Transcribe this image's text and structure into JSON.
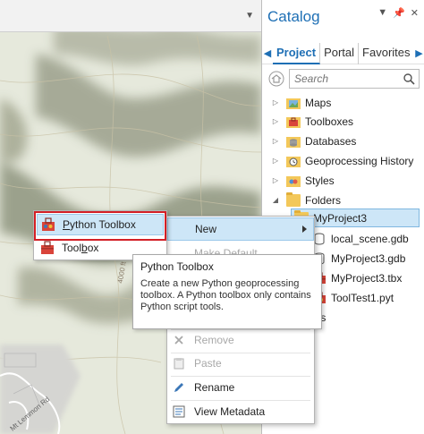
{
  "catalog": {
    "title": "Catalog",
    "tabs": [
      "Project",
      "Portal",
      "Favorites"
    ],
    "active_tab": "Project",
    "search_placeholder": "Search",
    "tree": [
      {
        "label": "Maps",
        "icon": "maps-icon"
      },
      {
        "label": "Toolboxes",
        "icon": "toolboxes-icon"
      },
      {
        "label": "Databases",
        "icon": "databases-icon"
      },
      {
        "label": "Geoprocessing History",
        "icon": "history-icon"
      },
      {
        "label": "Styles",
        "icon": "styles-icon"
      },
      {
        "label": "Folders",
        "icon": "folder-icon"
      },
      {
        "label": "MyProject3",
        "icon": "folder-icon"
      },
      {
        "label": "local_scene.gdb",
        "icon": "database-icon"
      },
      {
        "label": "MyProject3.gdb",
        "icon": "database-icon"
      },
      {
        "label": "MyProject3.tbx",
        "icon": "toolbox-icon"
      },
      {
        "label": "ToolTest1.pyt",
        "icon": "python-toolbox-icon"
      },
      {
        "label": "ocators",
        "icon": "locator-icon"
      }
    ]
  },
  "context_menu": {
    "new": "New",
    "make_default": "Make Default",
    "remove": "Remove",
    "paste": "Paste",
    "rename": "Rename",
    "view_metadata": "View Metadata"
  },
  "new_submenu": {
    "python_toolbox": "Python Toolbox",
    "toolbox_prefix": "Tool",
    "toolbox_underlined": "b",
    "toolbox_suffix": "ox",
    "python_prefix": "",
    "python_underlined": "P",
    "python_suffix": "ython Toolbox"
  },
  "tooltip": {
    "title": "Python Toolbox",
    "body": "Create a new Python geoprocessing toolbox. A Python toolbox only contains Python script tools."
  },
  "map": {
    "contour_label": "4000 ft",
    "road_label": "Mt Lemmon Rd"
  },
  "colors": {
    "accent": "#1e6fb5",
    "highlight": "#cde6f7",
    "callout": "#d31f26"
  }
}
